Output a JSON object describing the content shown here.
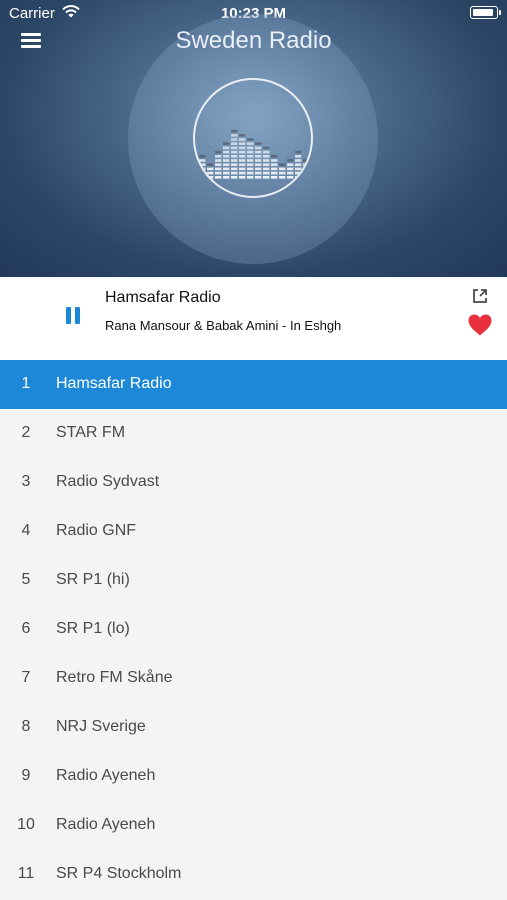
{
  "status_bar": {
    "carrier": "Carrier",
    "time": "10:23 PM"
  },
  "header": {
    "title": "Sweden Radio",
    "menu_icon": "hamburger-menu-icon",
    "logo_icon": "equalizer-logo-icon"
  },
  "now_playing": {
    "title": "Hamsafar Radio",
    "subtitle": "Rana Mansour & Babak Amini - In Eshgh",
    "state": "playing",
    "favorite": true,
    "accent_color": "#1e88d8",
    "favorite_color": "#e8303f"
  },
  "stations": [
    {
      "num": "1",
      "name": "Hamsafar Radio",
      "active": true
    },
    {
      "num": "2",
      "name": "STAR FM",
      "active": false
    },
    {
      "num": "3",
      "name": "Radio Sydvast",
      "active": false
    },
    {
      "num": "4",
      "name": "Radio GNF",
      "active": false
    },
    {
      "num": "5",
      "name": "SR P1 (hi)",
      "active": false
    },
    {
      "num": "6",
      "name": "SR P1 (lo)",
      "active": false
    },
    {
      "num": "7",
      "name": "Retro FM Skåne",
      "active": false
    },
    {
      "num": "8",
      "name": "NRJ Sverige",
      "active": false
    },
    {
      "num": "9",
      "name": "Radio Ayeneh",
      "active": false
    },
    {
      "num": "10",
      "name": "Radio Ayeneh",
      "active": false
    },
    {
      "num": "11",
      "name": "SR P4 Stockholm",
      "active": false
    }
  ]
}
